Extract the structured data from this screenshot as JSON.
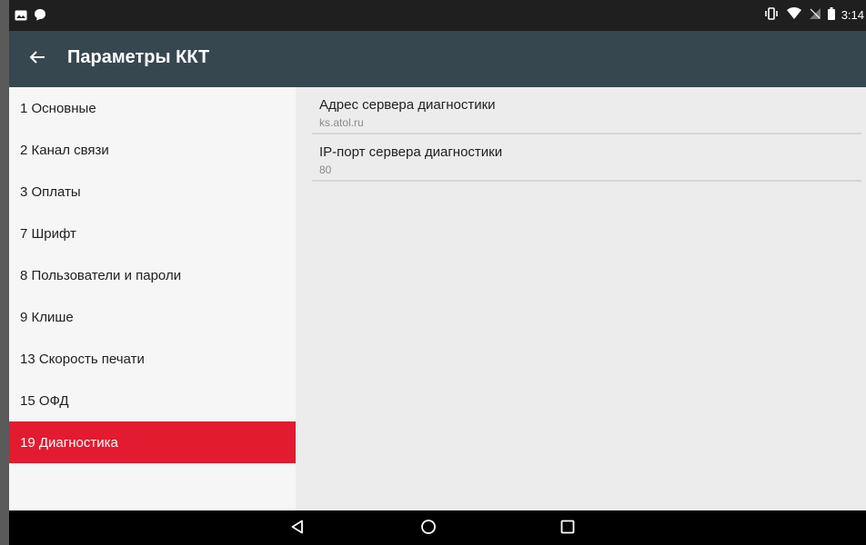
{
  "status_bar": {
    "time": "3:14",
    "left_icons": [
      "image-notification-icon",
      "message-notification-icon"
    ],
    "right_icons": [
      "vibrate-icon",
      "wifi-icon",
      "no-signal-icon",
      "battery-icon"
    ]
  },
  "app_bar": {
    "back_icon": "arrow-left-icon",
    "title": "Параметры ККТ"
  },
  "sidebar": {
    "items": [
      {
        "label": "1 Основные",
        "active": false
      },
      {
        "label": "2 Канал связи",
        "active": false
      },
      {
        "label": "3 Оплаты",
        "active": false
      },
      {
        "label": "7 Шрифт",
        "active": false
      },
      {
        "label": "8 Пользователи и пароли",
        "active": false
      },
      {
        "label": "9 Клише",
        "active": false
      },
      {
        "label": "13 Скорость печати",
        "active": false
      },
      {
        "label": "15 ОФД",
        "active": false
      },
      {
        "label": "19 Диагностика",
        "active": true
      }
    ]
  },
  "settings": {
    "items": [
      {
        "title": "Адрес сервера диагностики",
        "value": "ks.atol.ru"
      },
      {
        "title": "IP-порт сервера диагностики",
        "value": "80"
      }
    ]
  },
  "nav_bar": {
    "icons": [
      "back-triangle-icon",
      "home-circle-icon",
      "recents-square-icon"
    ]
  },
  "colors": {
    "app_bar": "#37474f",
    "active_item": "#e31b30",
    "status_bar": "#1f1f1f"
  }
}
